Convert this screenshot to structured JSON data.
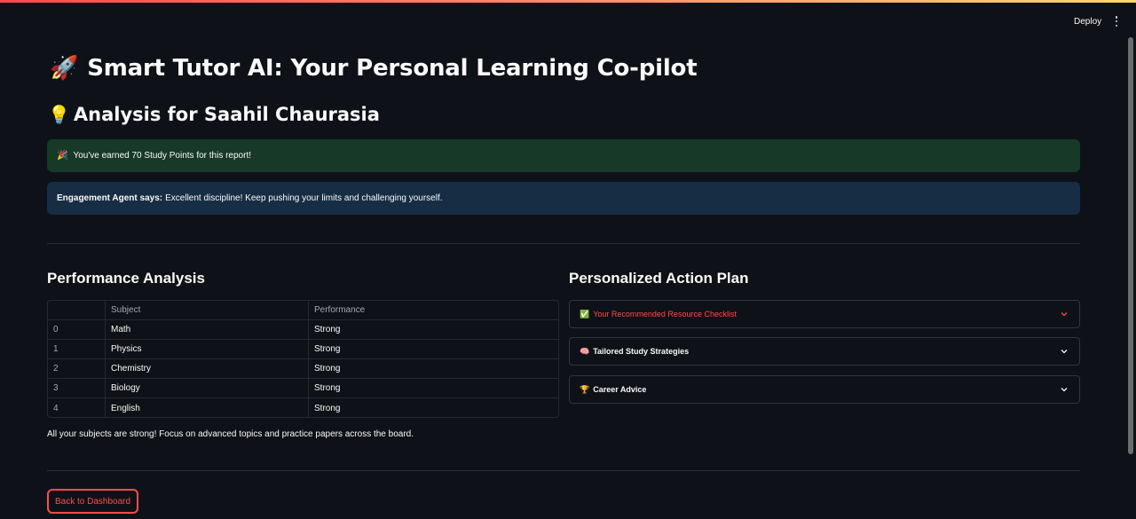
{
  "header": {
    "deploy_label": "Deploy"
  },
  "title": {
    "icon": "🚀",
    "text": "Smart Tutor AI: Your Personal Learning Co-pilot"
  },
  "subtitle": {
    "icon": "💡",
    "text": "Analysis for Saahil Chaurasia"
  },
  "success_alert": {
    "icon": "🎉",
    "text": "You've earned 70 Study Points for this report!"
  },
  "info_alert": {
    "label": "Engagement Agent says:",
    "text": "Excellent discipline! Keep pushing your limits and challenging yourself."
  },
  "performance": {
    "heading": "Performance Analysis",
    "columns": [
      "",
      "Subject",
      "Performance"
    ],
    "rows": [
      {
        "index": "0",
        "subject": "Math",
        "performance": "Strong"
      },
      {
        "index": "1",
        "subject": "Physics",
        "performance": "Strong"
      },
      {
        "index": "2",
        "subject": "Chemistry",
        "performance": "Strong"
      },
      {
        "index": "3",
        "subject": "Biology",
        "performance": "Strong"
      },
      {
        "index": "4",
        "subject": "English",
        "performance": "Strong"
      }
    ],
    "caption": "All your subjects are strong! Focus on advanced topics and practice papers across the board."
  },
  "action_plan": {
    "heading": "Personalized Action Plan",
    "expanders": [
      {
        "icon": "✅",
        "label": "Your Recommended Resource Checklist"
      },
      {
        "icon": "🧠",
        "label": "Tailored Study Strategies"
      },
      {
        "icon": "🏆",
        "label": "Career Advice"
      }
    ]
  },
  "back_button": {
    "label": "Back to Dashboard"
  },
  "colors": {
    "background": "#0e1117",
    "accent": "#ff4b4b",
    "success_bg": "#173928",
    "info_bg": "#172d43"
  }
}
